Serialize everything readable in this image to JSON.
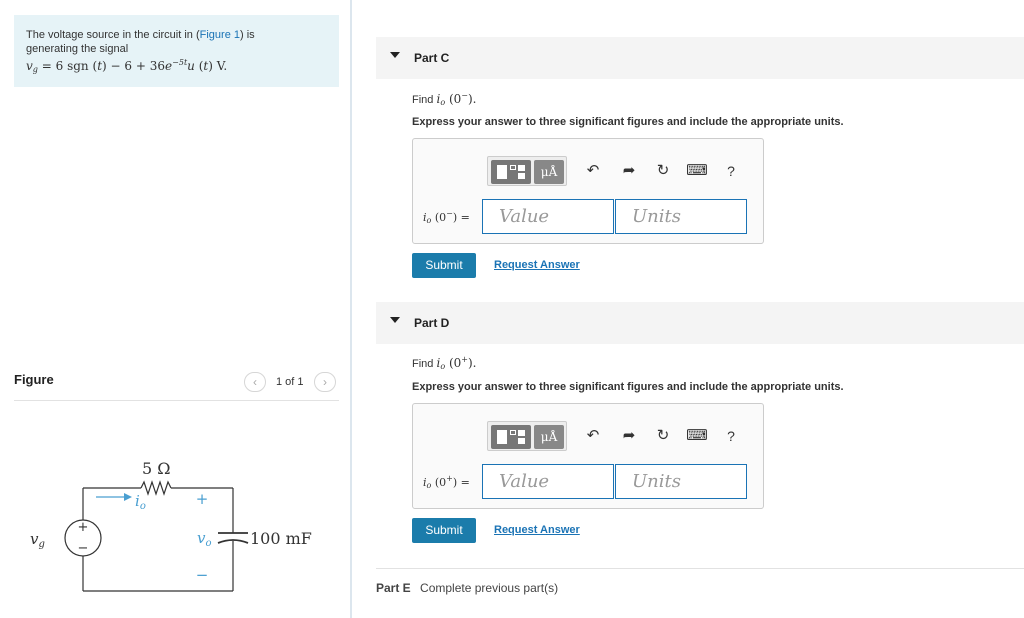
{
  "problem": {
    "text_before_link": "The voltage source in the circuit in (",
    "link_text": "Figure 1",
    "text_after_link": ") is",
    "line2": "generating the signal",
    "equation": "v_g = 6 sgn(t) − 6 + 36e^(−5t) u(t) V."
  },
  "figure_panel": {
    "title": "Figure",
    "count": "1 of 1",
    "prev_icon": "chevron-left-icon",
    "next_icon": "chevron-right-icon",
    "circuit": {
      "resistor_label": "5 Ω",
      "current_label": "i",
      "current_sub": "o",
      "source_label": "v",
      "source_sub": "g",
      "output_label": "v",
      "output_sub": "o",
      "plus": "+",
      "minus": "−",
      "capacitor_label": "100 mF"
    }
  },
  "parts": [
    {
      "header": "Part C",
      "find": "Find",
      "find_expr": "i_o(0^−)",
      "instruction": "Express your answer to three significant figures and include the appropriate units.",
      "answer_label": "i_o(0^−) =",
      "value_placeholder": "Value",
      "units_placeholder": "Units",
      "submit": "Submit",
      "request": "Request Answer"
    },
    {
      "header": "Part D",
      "find": "Find",
      "find_expr": "i_o(0^+)",
      "instruction": "Express your answer to three significant figures and include the appropriate units.",
      "answer_label": "i_o(0^+) =",
      "value_placeholder": "Value",
      "units_placeholder": "Units",
      "submit": "Submit",
      "request": "Request Answer"
    }
  ],
  "toolbar": {
    "units_button": "μÅ",
    "help": "?",
    "icons": [
      "templates-icon",
      "units-icon",
      "undo-icon",
      "redo-icon",
      "reset-icon",
      "keyboard-icon",
      "help-icon"
    ]
  },
  "part_e": {
    "label": "Part E",
    "status": "Complete previous part(s)"
  }
}
